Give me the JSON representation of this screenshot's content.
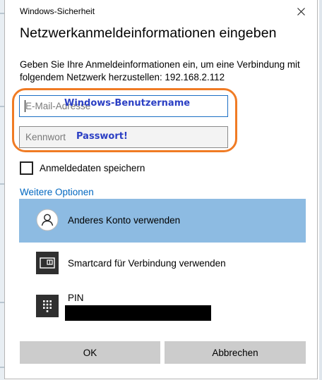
{
  "window": {
    "title": "Windows-Sicherheit"
  },
  "dialog": {
    "heading": "Netzwerkanmeldeinformationen eingeben",
    "description": "Geben Sie Ihre Anmeldeinformationen ein, um eine Verbindung mit folgendem Netzwerk herzustellen: 192.168.2.112"
  },
  "fields": {
    "email_placeholder": "E-Mail-Adresse",
    "password_placeholder": "Kennwort"
  },
  "annotations": {
    "username_note": "Windows-Benutzername",
    "password_note": "Passwort!"
  },
  "remember": {
    "label": "Anmeldedaten speichern",
    "checked": false
  },
  "more_options": {
    "label": "Weitere Optionen"
  },
  "options": [
    {
      "label": "Anderes Konto verwenden",
      "icon": "user-icon",
      "selected": true
    },
    {
      "label": "Smartcard für Verbindung verwenden",
      "icon": "smartcard-icon",
      "selected": false
    },
    {
      "label": "PIN",
      "icon": "keypad-icon",
      "selected": false
    }
  ],
  "buttons": {
    "ok": "OK",
    "cancel": "Abbrechen"
  },
  "colors": {
    "accent": "#0067c0",
    "selection": "#8dbbe2",
    "annotation_ring": "#f07b24",
    "annotation_text": "#2b3fc4"
  }
}
